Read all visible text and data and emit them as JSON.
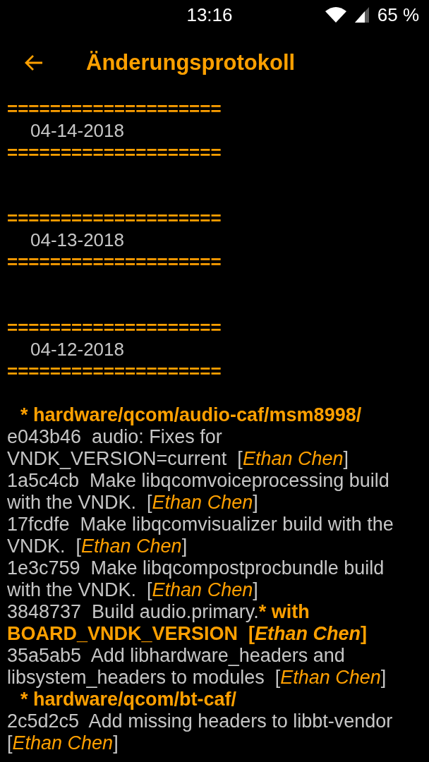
{
  "status_bar": {
    "time": "13:16",
    "battery": "65 %"
  },
  "app_bar": {
    "title": "Änderungsprotokoll"
  },
  "changelog": [
    {
      "separator_top": "====================",
      "date": "04-14-2018",
      "separator_bottom": "===================="
    },
    {
      "separator_top": "====================",
      "date": "04-13-2018",
      "separator_bottom": "===================="
    },
    {
      "separator_top": "====================",
      "date": "04-12-2018",
      "separator_bottom": "====================",
      "projects": [
        {
          "path": "* hardware/qcom/audio-caf/msm8998/",
          "commits": [
            {
              "runs": [
                {
                  "kind": "plain",
                  "text": "e043b46  audio: Fixes for VNDK_VERSION=current  ["
                },
                {
                  "kind": "author",
                  "text": "Ethan Chen"
                },
                {
                  "kind": "plain",
                  "text": "]"
                }
              ]
            },
            {
              "runs": [
                {
                  "kind": "plain",
                  "text": "1a5c4cb  Make libqcomvoiceprocessing build with the VNDK.  ["
                },
                {
                  "kind": "author",
                  "text": "Ethan Chen"
                },
                {
                  "kind": "plain",
                  "text": "]"
                }
              ]
            },
            {
              "runs": [
                {
                  "kind": "plain",
                  "text": "17fcdfe  Make libqcomvisualizer build with the VNDK.  ["
                },
                {
                  "kind": "author",
                  "text": "Ethan Chen"
                },
                {
                  "kind": "plain",
                  "text": "]"
                }
              ]
            },
            {
              "runs": [
                {
                  "kind": "plain",
                  "text": "1e3c759  Make libqcompostprocbundle build with the VNDK.  ["
                },
                {
                  "kind": "author",
                  "text": "Ethan Chen"
                },
                {
                  "kind": "plain",
                  "text": "]"
                }
              ]
            },
            {
              "runs": [
                {
                  "kind": "plain",
                  "text": "3848737  Build audio.primary."
                },
                {
                  "kind": "strong",
                  "text": "* with BOARD_VNDK_VERSION  ["
                },
                {
                  "kind": "strong-author",
                  "text": "Ethan Chen"
                },
                {
                  "kind": "strong",
                  "text": "]"
                }
              ]
            },
            {
              "runs": [
                {
                  "kind": "plain",
                  "text": "35a5ab5  Add libhardware_headers and libsystem_headers to modules  ["
                },
                {
                  "kind": "author",
                  "text": "Ethan Chen"
                },
                {
                  "kind": "plain",
                  "text": "]"
                }
              ]
            }
          ]
        },
        {
          "path": "* hardware/qcom/bt-caf/",
          "commits": [
            {
              "runs": [
                {
                  "kind": "plain",
                  "text": "2c5d2c5  Add missing headers to libbt-vendor  ["
                },
                {
                  "kind": "author",
                  "text": "Ethan Chen"
                },
                {
                  "kind": "plain",
                  "text": "]"
                }
              ]
            }
          ]
        }
      ]
    }
  ]
}
